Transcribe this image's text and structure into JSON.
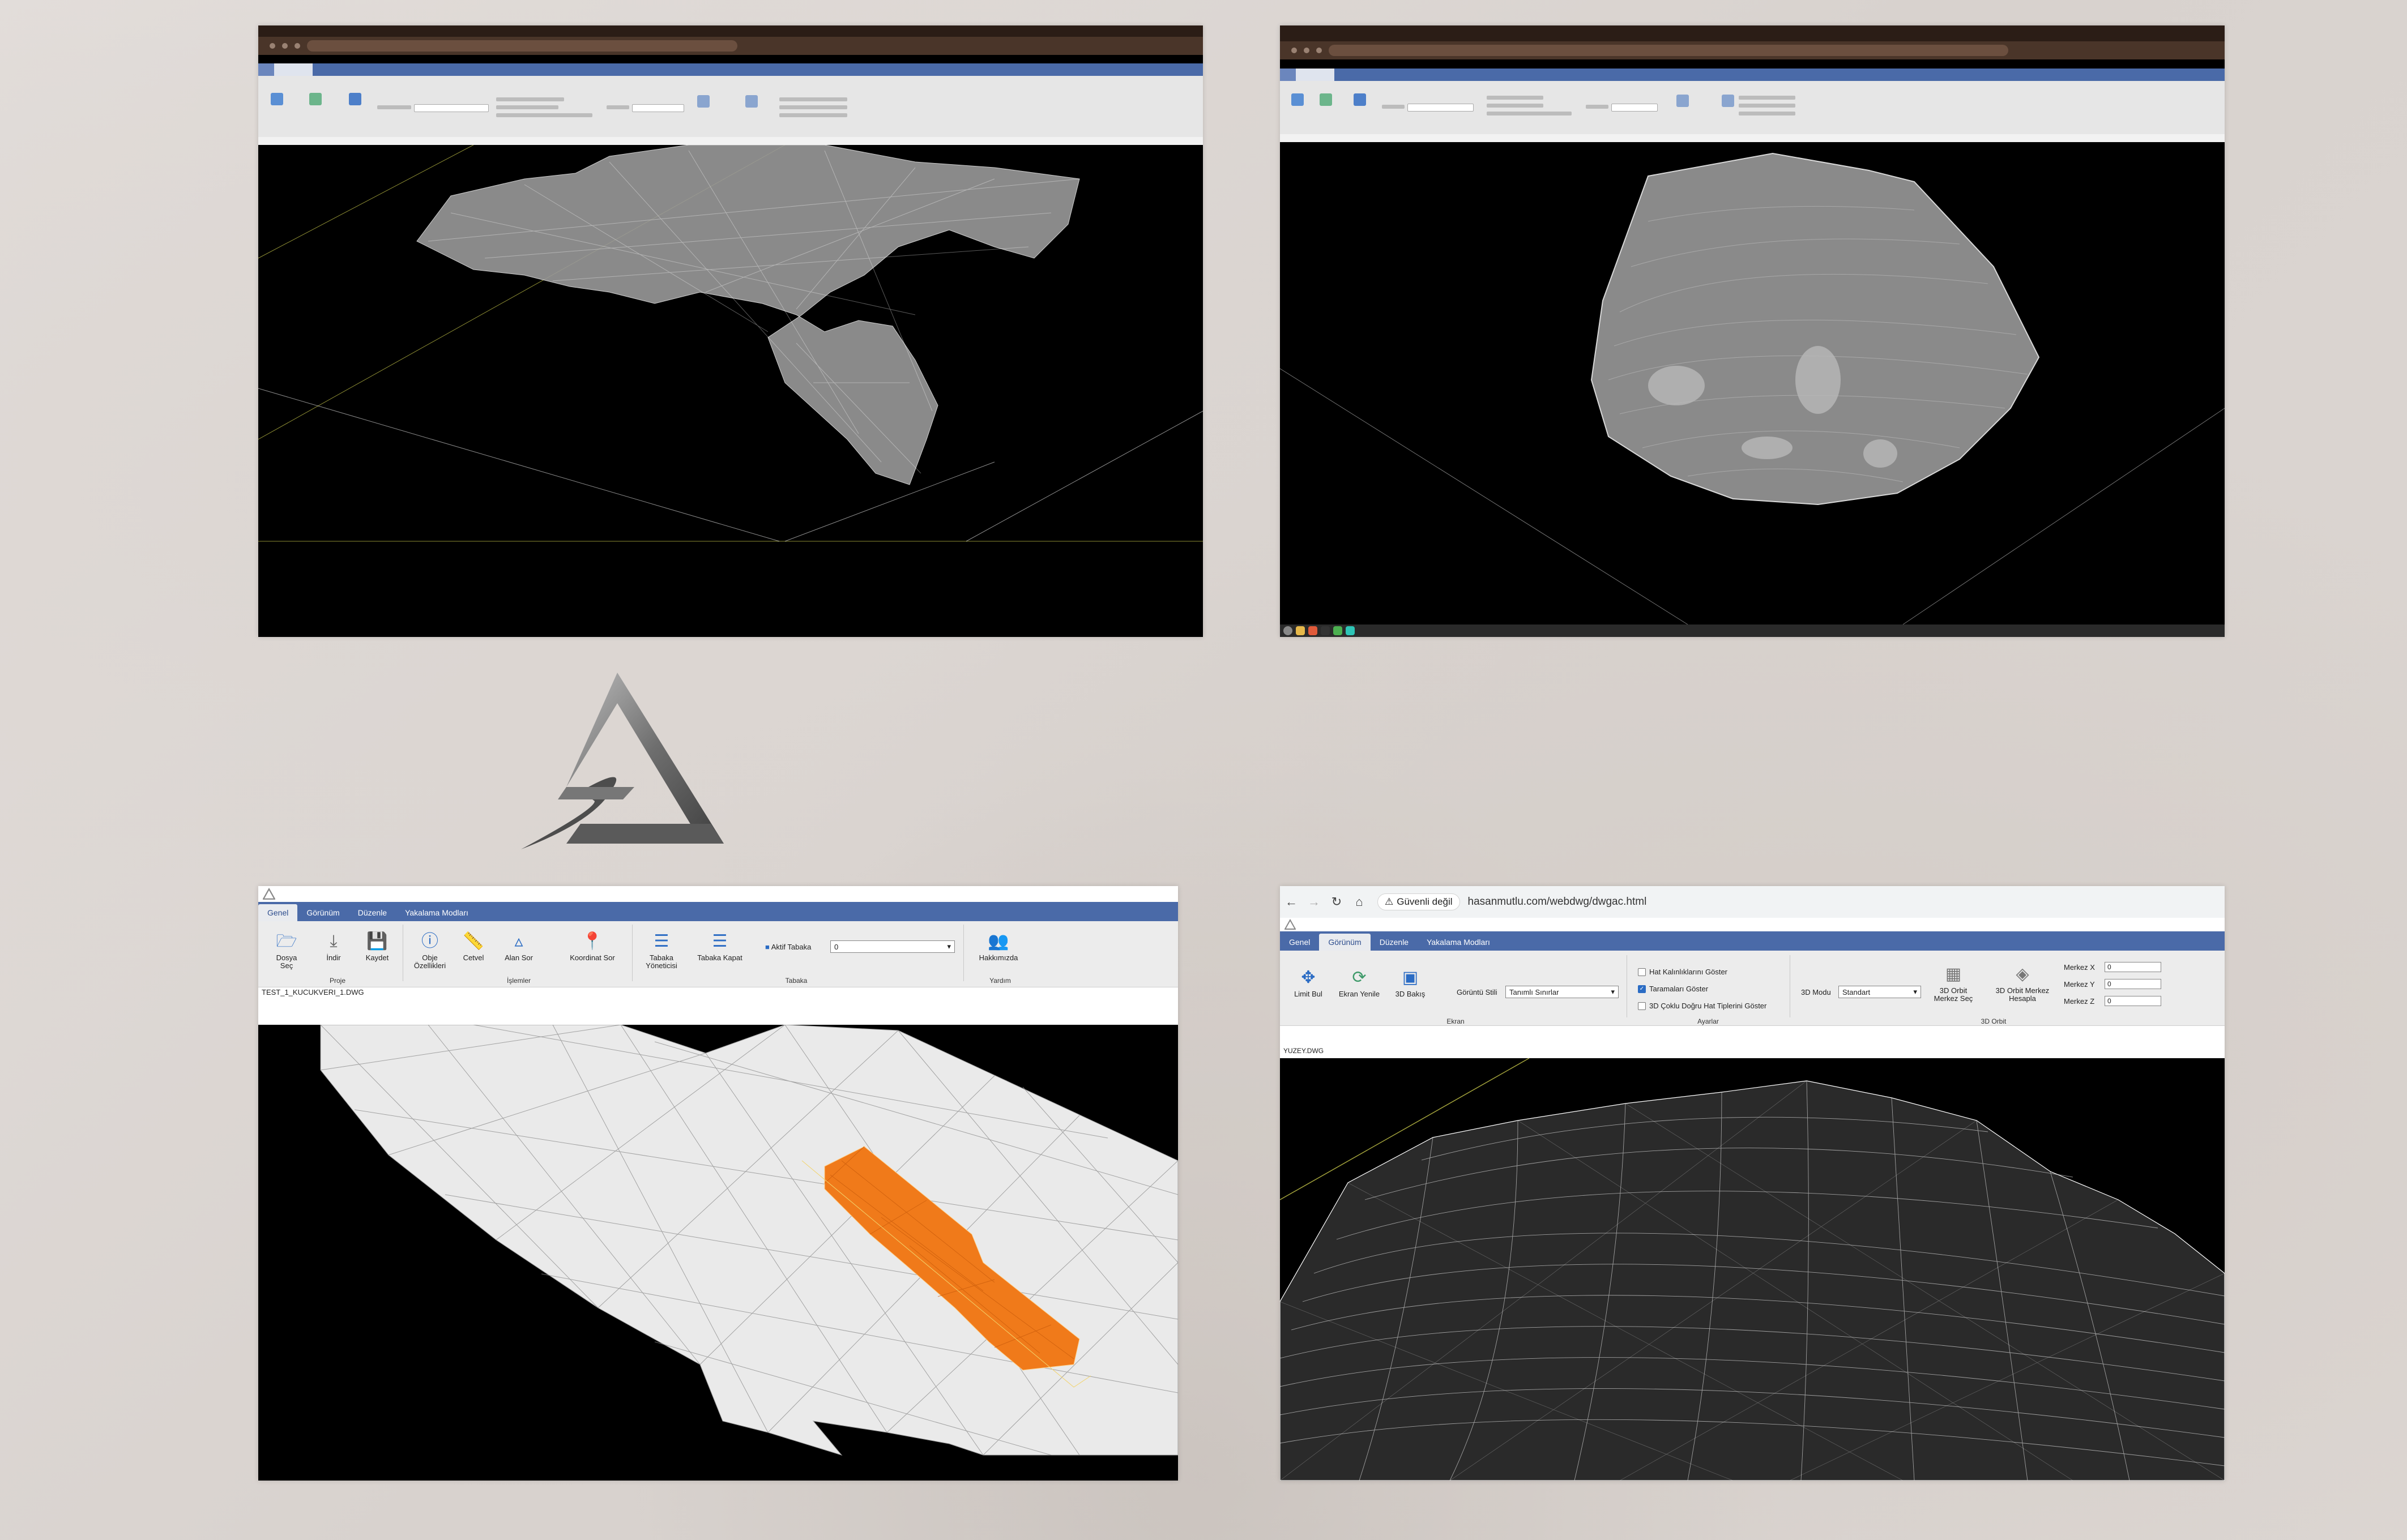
{
  "logo": {
    "name": "brand-logo"
  },
  "colors": {
    "ribbon_tab_bar": "#4a6aa8",
    "mesh_orange": "#f07a1a",
    "viewport_bg": "#000000",
    "ribbon_bg": "#ececec"
  },
  "panel_bottom_left": {
    "ribbon_tabs": [
      "Genel",
      "Görünüm",
      "Düzenle",
      "Yakalama Modları"
    ],
    "active_tab": "Genel",
    "tools": {
      "dosya_sec": "Dosya Seç",
      "indir": "İndir",
      "kaydet": "Kaydet",
      "obje_ozellikleri": "Obje Özellikleri",
      "cetvel": "Cetvel",
      "alan_sor": "Alan Sor",
      "koordinat_sor": "Koordinat Sor",
      "tabaka_yoneticisi": "Tabaka Yöneticisi",
      "tabaka_kapat": "Tabaka Kapat",
      "aktif_tabaka_label": "Aktif Tabaka",
      "aktif_tabaka_value": "0",
      "hakkimizda": "Hakkımızda"
    },
    "groups": {
      "proje": "Proje",
      "islemler": "İşlemler",
      "tabaka": "Tabaka",
      "yardim": "Yardım"
    },
    "file_name": "TEST_1_KUCUKVERI_1.DWG"
  },
  "panel_bottom_right": {
    "warning": "Güvenli değil",
    "url": "hasanmutlu.com/webdwg/dwgac.html",
    "ribbon_tabs": [
      "Genel",
      "Görünüm",
      "Düzenle",
      "Yakalama Modları"
    ],
    "active_tab": "Görünüm",
    "tools": {
      "limit_bul": "Limit Bul",
      "ekran_yenile": "Ekran Yenile",
      "3d_bakis": "3D Bakış",
      "gorunum_stili_label": "Görüntü Stili",
      "gorunum_stili_value": "Tanımlı Sınırlar",
      "hat_kalinliklari": "Hat Kalınlıklarını Göster",
      "taramalari_goster": "Taramaları Göster",
      "3d_coklu_dogru": "3D Çoklu Doğru Hat Tiplerini Göster",
      "3d_modu_label": "3D Modu",
      "3d_modu_value": "Standart",
      "3d_orbit_merkez_sec": "3D Orbit Merkez Seç",
      "3d_orbit_merkez_hesapla": "3D Orbit Merkez Hesapla",
      "merkez_x_label": "Merkez X",
      "merkez_y_label": "Merkez Y",
      "merkez_z_label": "Merkez Z",
      "merkez_x": "0",
      "merkez_y": "0",
      "merkez_z": "0"
    },
    "groups": {
      "ekran": "Ekran",
      "ayarlar": "Ayarlar",
      "orbit": "3D Orbit"
    },
    "file_name": "YUZEY.DWG"
  }
}
